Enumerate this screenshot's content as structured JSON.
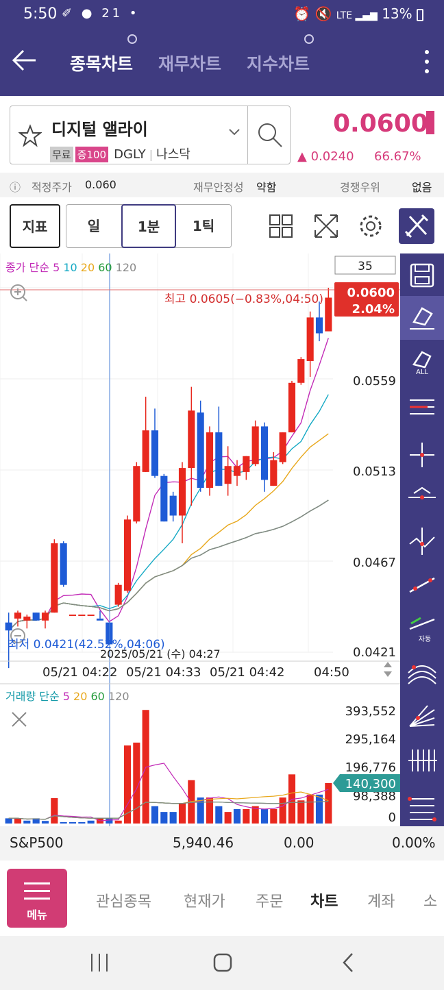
{
  "status_bar": {
    "time": "5:50",
    "left_icons": "✐ ● 21 •",
    "right_text": "13%"
  },
  "header": {
    "tabs": [
      {
        "label": "종목차트",
        "active": true
      },
      {
        "label": "재무차트",
        "active": false
      },
      {
        "label": "지수차트",
        "active": false
      }
    ]
  },
  "stock": {
    "name": "디지털 앨라이",
    "tags": [
      "무료",
      "증100"
    ],
    "ticker": "DGLY",
    "market": "나스닥",
    "price": "0.0600",
    "change": "▲ 0.0240",
    "change_pct": "66.67%",
    "accent": "#d63a7a"
  },
  "info_row": {
    "fair_price_label": "적정주가",
    "fair_price_value": "0.060",
    "fin_label": "재무안정성",
    "fin_value": "약함",
    "comp_label": "경쟁우위",
    "comp_value": "없음"
  },
  "toolbar": {
    "indicator_label": "지표",
    "periods": [
      "일",
      "1분",
      "1틱"
    ],
    "period_selected": "1분"
  },
  "chart_data": {
    "type": "candlestick",
    "title": "",
    "legend_price": {
      "prefix": "종가 단순",
      "items": [
        "5",
        "10",
        "20",
        "60",
        "120"
      ]
    },
    "count_box": "35",
    "high_label": "최고 0.0605(−0.83%,04:50)",
    "low_label": "최저 0.0421(42.52%,04:06)",
    "crosshair_label": "2025/05/21 (수) 04:27",
    "current_price_tag": "0.0600",
    "current_pct_tag": "2.04%",
    "price_axis_labels": [
      "0.0559",
      "0.0513",
      "0.0467",
      "0.0421"
    ],
    "ylim": [
      0.0421,
      0.0605
    ],
    "x_labels": [
      "05/21 04:22",
      "05/21 04:33",
      "05/21 04:42",
      "04:50"
    ],
    "candles": [
      {
        "o": 0.0436,
        "h": 0.0441,
        "l": 0.0413,
        "c": 0.0432
      },
      {
        "o": 0.0438,
        "h": 0.0442,
        "l": 0.0434,
        "c": 0.0441
      },
      {
        "o": 0.0437,
        "h": 0.044,
        "l": 0.0433,
        "c": 0.0439
      },
      {
        "o": 0.0441,
        "h": 0.0441,
        "l": 0.0437,
        "c": 0.0437
      },
      {
        "o": 0.0437,
        "h": 0.0442,
        "l": 0.0433,
        "c": 0.0441
      },
      {
        "o": 0.0441,
        "h": 0.0478,
        "l": 0.0441,
        "c": 0.0476
      },
      {
        "o": 0.0476,
        "h": 0.0477,
        "l": 0.0454,
        "c": 0.0455
      },
      {
        "o": 0.044,
        "h": 0.044,
        "l": 0.044,
        "c": 0.044
      },
      {
        "o": 0.044,
        "h": 0.044,
        "l": 0.044,
        "c": 0.044
      },
      {
        "o": 0.044,
        "h": 0.044,
        "l": 0.044,
        "c": 0.044
      },
      {
        "o": 0.0438,
        "h": 0.0442,
        "l": 0.0438,
        "c": 0.0437
      },
      {
        "o": 0.0436,
        "h": 0.0436,
        "l": 0.0425,
        "c": 0.0425
      },
      {
        "o": 0.0445,
        "h": 0.0456,
        "l": 0.0444,
        "c": 0.0455
      },
      {
        "o": 0.0452,
        "h": 0.049,
        "l": 0.0451,
        "c": 0.0488
      },
      {
        "o": 0.0487,
        "h": 0.0517,
        "l": 0.0486,
        "c": 0.0515
      },
      {
        "o": 0.0512,
        "h": 0.055,
        "l": 0.0512,
        "c": 0.0533
      },
      {
        "o": 0.0533,
        "h": 0.0544,
        "l": 0.0509,
        "c": 0.051
      },
      {
        "o": 0.051,
        "h": 0.0511,
        "l": 0.0487,
        "c": 0.0487
      },
      {
        "o": 0.05,
        "h": 0.0502,
        "l": 0.0487,
        "c": 0.049
      },
      {
        "o": 0.049,
        "h": 0.0517,
        "l": 0.0476,
        "c": 0.0514
      },
      {
        "o": 0.0514,
        "h": 0.0555,
        "l": 0.0495,
        "c": 0.0543
      },
      {
        "o": 0.0542,
        "h": 0.0548,
        "l": 0.0502,
        "c": 0.0504
      },
      {
        "o": 0.0504,
        "h": 0.0535,
        "l": 0.05,
        "c": 0.0532
      },
      {
        "o": 0.0532,
        "h": 0.0545,
        "l": 0.0505,
        "c": 0.0505
      },
      {
        "o": 0.0506,
        "h": 0.0525,
        "l": 0.05,
        "c": 0.0515
      },
      {
        "o": 0.051,
        "h": 0.0518,
        "l": 0.0505,
        "c": 0.0515
      },
      {
        "o": 0.0512,
        "h": 0.052,
        "l": 0.0508,
        "c": 0.052
      },
      {
        "o": 0.0516,
        "h": 0.0538,
        "l": 0.0515,
        "c": 0.0535
      },
      {
        "o": 0.0535,
        "h": 0.0537,
        "l": 0.0502,
        "c": 0.0508
      },
      {
        "o": 0.0505,
        "h": 0.0522,
        "l": 0.0505,
        "c": 0.0518
      },
      {
        "o": 0.0517,
        "h": 0.0532,
        "l": 0.0516,
        "c": 0.0532
      },
      {
        "o": 0.0532,
        "h": 0.0558,
        "l": 0.0532,
        "c": 0.0557
      },
      {
        "o": 0.0557,
        "h": 0.057,
        "l": 0.0556,
        "c": 0.0569
      },
      {
        "o": 0.0568,
        "h": 0.0593,
        "l": 0.056,
        "c": 0.059
      },
      {
        "o": 0.059,
        "h": 0.0598,
        "l": 0.0578,
        "c": 0.0582
      },
      {
        "o": 0.0583,
        "h": 0.0605,
        "l": 0.0584,
        "c": 0.06
      }
    ],
    "ma_series": [
      {
        "name": "5",
        "color": "#c22bb7"
      },
      {
        "name": "10",
        "color": "#14a9c4"
      },
      {
        "name": "20",
        "color": "#e8a81c"
      },
      {
        "name": "60",
        "color": "#239a3a"
      },
      {
        "name": "120",
        "color": "#888888"
      }
    ],
    "volume": {
      "legend_prefix": "거래량 단순",
      "legend_items": [
        "5",
        "20",
        "60",
        "120"
      ],
      "axis_labels": [
        "393,552",
        "295,164",
        "196,776",
        "98,388",
        "0"
      ],
      "current_tag": "140,300",
      "ylim": [
        0,
        393552
      ],
      "bars": [
        18000,
        18000,
        10000,
        18000,
        9000,
        88000,
        5000,
        5000,
        5000,
        10000,
        20000,
        20000,
        10000,
        270000,
        280000,
        393000,
        60000,
        40000,
        40000,
        70000,
        150000,
        90000,
        90000,
        60000,
        40000,
        50000,
        50000,
        60000,
        50000,
        50000,
        90000,
        170000,
        80000,
        100000,
        100000,
        140000
      ],
      "bar_dirs": [
        "down",
        "up",
        "down",
        "down",
        "down",
        "up",
        "down",
        "down",
        "down",
        "down",
        "up",
        "down",
        "up",
        "up",
        "up",
        "up",
        "down",
        "down",
        "down",
        "up",
        "up",
        "down",
        "up",
        "down",
        "up",
        "down",
        "up",
        "up",
        "down",
        "up",
        "up",
        "up",
        "up",
        "up",
        "down",
        "up"
      ]
    }
  },
  "index_row": {
    "name": "S&P500",
    "value": "5,940.46",
    "change": "0.00",
    "pct": "0.00%"
  },
  "bottom_nav": {
    "menu_label": "메뉴",
    "items": [
      "관심종목",
      "현재가",
      "주문",
      "차트",
      "계좌",
      "소"
    ],
    "active": "차트"
  }
}
